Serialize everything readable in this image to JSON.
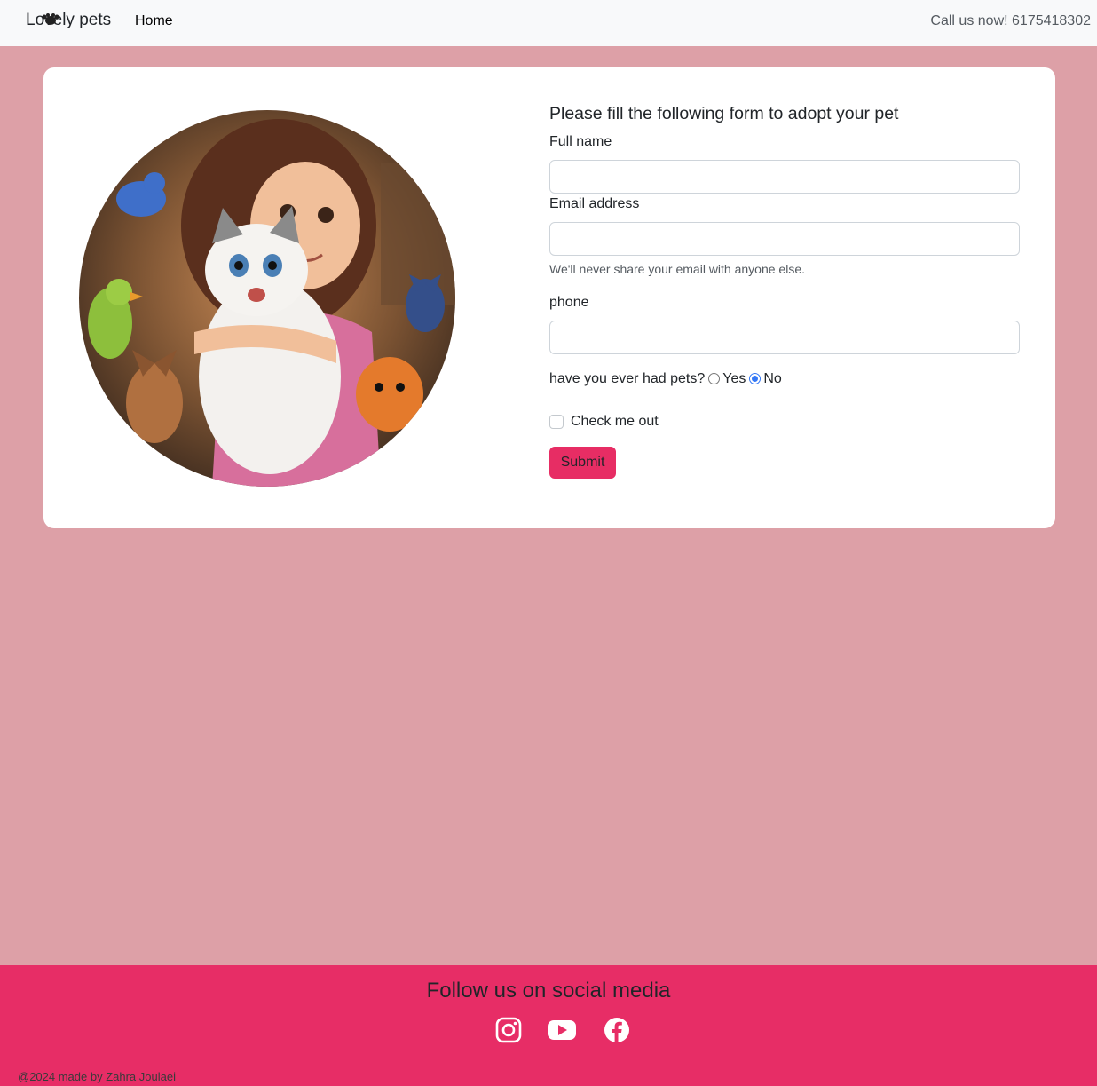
{
  "navbar": {
    "brand": "Lovely pets",
    "home": "Home",
    "call": "Call us now! 6175418302"
  },
  "form": {
    "title": "Please fill the following form to adopt your pet",
    "full_name_label": "Full name",
    "email_label": "Email address",
    "email_help": "We'll never share your email with anyone else.",
    "phone_label": "phone",
    "pets_question": "have you ever had pets?",
    "yes_label": "Yes",
    "no_label": "No",
    "selected_option": "No",
    "check_label": "Check me out",
    "checkbox_checked": false,
    "submit_label": "Submit"
  },
  "footer": {
    "title": "Follow us on social media",
    "icons": [
      "instagram-icon",
      "youtube-icon",
      "facebook-icon"
    ],
    "copyright": "@2024 made by Zahra Joulaei"
  },
  "colors": {
    "page_bg": "#dda0a7",
    "accent": "#e72d64",
    "navbar_bg": "#f8f9fa"
  }
}
